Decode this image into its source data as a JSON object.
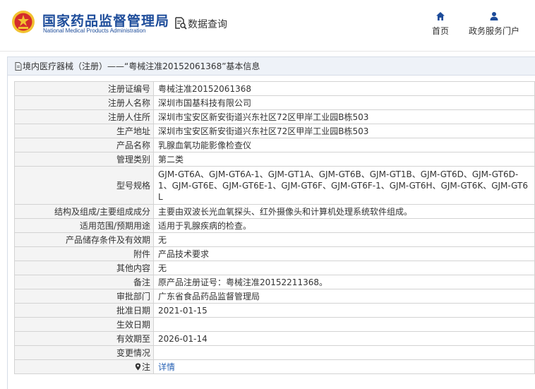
{
  "header": {
    "title_cn": "国家药品监督管理局",
    "title_en": "National Medical Products Administration",
    "query_label": "数据查询",
    "nav": {
      "home": "首页",
      "gov_portal": "政务服务门户"
    }
  },
  "panel": {
    "breadcrumb": "境内医疗器械（注册）——“粤械注准20152061368”基本信息"
  },
  "fields": [
    {
      "label": "注册证编号",
      "value": "粤械注准20152061368"
    },
    {
      "label": "注册人名称",
      "value": "深圳市国基科技有限公司"
    },
    {
      "label": "注册人住所",
      "value": "深圳市宝安区新安街道兴东社区72区甲岸工业园B栋503"
    },
    {
      "label": "生产地址",
      "value": "深圳市宝安区新安街道兴东社区72区甲岸工业园B栋503"
    },
    {
      "label": "产品名称",
      "value": "乳腺血氧功能影像检查仪"
    },
    {
      "label": "管理类别",
      "value": "第二类"
    },
    {
      "label": "型号规格",
      "value": "GJM-GT6A、GJM-GT6A-1、GJM-GT1A、GJM-GT6B、GJM-GT1B、GJM-GT6D、GJM-GT6D-1、GJM-GT6E、GJM-GT6E-1、GJM-GT6F、GJM-GT6F-1、GJM-GT6H、GJM-GT6K、GJM-GT6L"
    },
    {
      "label": "结构及组成/主要组成成分",
      "value": "主要由双波长光血氧探头、红外摄像头和计算机处理系统软件组成。"
    },
    {
      "label": "适用范围/预期用途",
      "value": "适用于乳腺疾病的检查。"
    },
    {
      "label": "产品储存条件及有效期",
      "value": "无"
    },
    {
      "label": "附件",
      "value": "产品技术要求"
    },
    {
      "label": "其他内容",
      "value": "无"
    },
    {
      "label": "备注",
      "value": "原产品注册证号：粤械注准20152211368。"
    },
    {
      "label": "审批部门",
      "value": "广东省食品药品监督管理局"
    },
    {
      "label": "批准日期",
      "value": "2021-01-15"
    },
    {
      "label": "生效日期",
      "value": ""
    },
    {
      "label": "有效期至",
      "value": "2026-01-14"
    },
    {
      "label": "变更情况",
      "value": ""
    },
    {
      "label": "注",
      "value": "详情"
    }
  ],
  "colors": {
    "brand_blue": "#1d4c9a",
    "link_blue": "#2a63b5",
    "emblem_red": "#d42c2c",
    "emblem_gold": "#f2c230"
  },
  "icons": {
    "logo": "nmpa-emblem-icon",
    "query": "data-query-icon",
    "home": "home-icon",
    "gov": "user-icon",
    "breadcrumb": "document-icon",
    "note": "map-pin-icon"
  }
}
